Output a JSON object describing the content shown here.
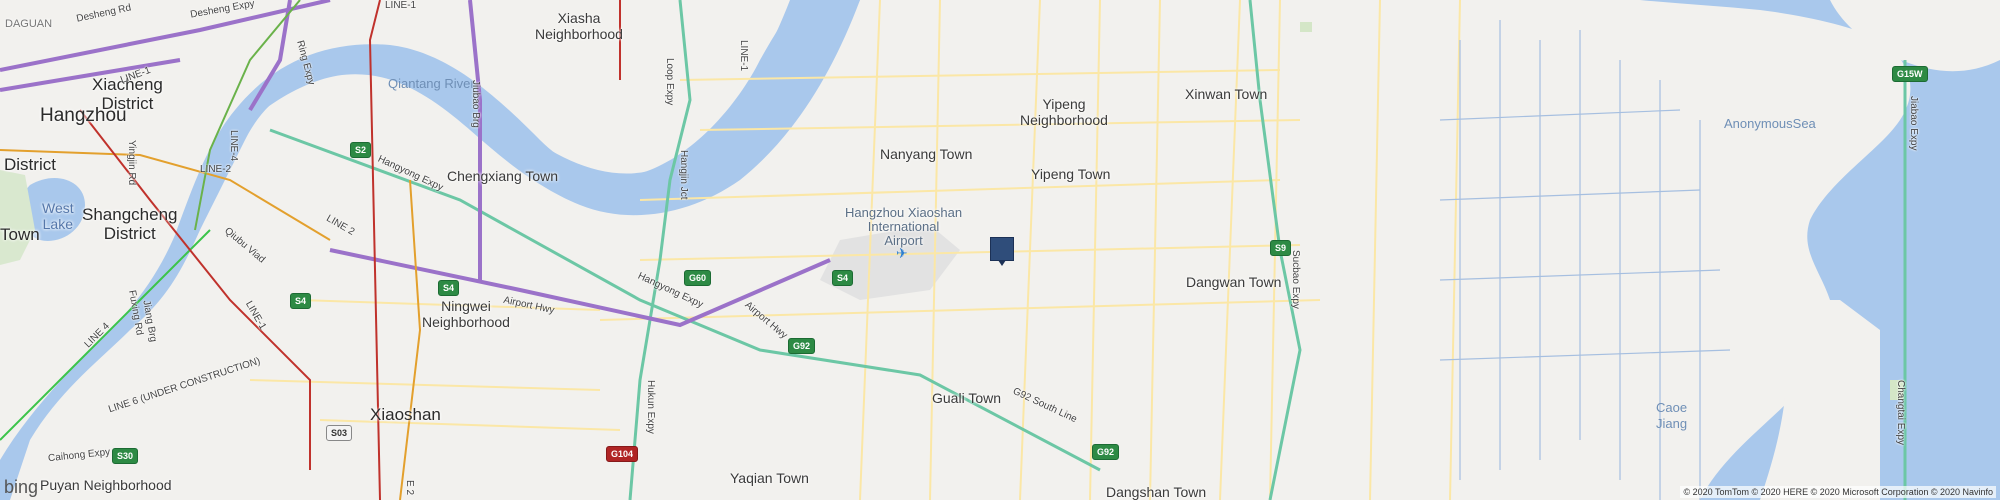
{
  "map": {
    "labels": {
      "daguan": "DAGUAN",
      "xiacheng": "Xiacheng\nDistrict",
      "hangzhou": "Hangzhou",
      "district": "District",
      "west_lake": "West\nLake",
      "town_left": "Town",
      "shangcheng": "Shangcheng\nDistrict",
      "xiasha": "Xiasha\nNeighborhood",
      "qiantang": "Qiantang River",
      "chengxiang": "Chengxiang Town",
      "ningwei": "Ningwei\nNeighborhood",
      "xiaoshan": "Xiaoshan",
      "puyan": "Puyan Neighborhood",
      "nanyang": "Nanyang Town",
      "yipeng_nb": "Yipeng\nNeighborhood",
      "yipeng_town": "Yipeng Town",
      "xinwan": "Xinwan Town",
      "airport": "Hangzhou Xiaoshan\nInternational\nAirport",
      "dangwan": "Dangwan Town",
      "guali": "Guali Town",
      "yaqian": "Yaqian Town",
      "dangshan": "Dangshan Town",
      "anonymous_sea": "AnonymousSea",
      "caoe": "Caoe\nJiang"
    },
    "roads": {
      "desheng1": "Desheng Rd",
      "desheng2": "Desheng Expy",
      "line1_top": "LINE-1",
      "line1_a": "LINE-1",
      "line1_b": "LINE-1",
      "line1_c": "LINE-1",
      "line2_a": "LINE 2",
      "line2_b": "LINE-2",
      "line4_a": "LINE-4",
      "line4_b": "LINE 4",
      "line6": "LINE 6 (UNDER CONSTRUCTION)",
      "hangyong1": "Hangyong Expy",
      "hangyong2": "Hangyong Expy",
      "airport_hwy": "Airport Hwy",
      "airport_hwy2": "Airport Hwy",
      "jiubao": "Jiubao Brg",
      "ring": "Ring Expy",
      "loop": "Loop Expy",
      "hangjin": "Hangjin Jct",
      "yingjin": "Yingjin Rd",
      "qiubu": "Qiubu Viad",
      "fuxing": "Fuxing Rd",
      "jiang_brg": "Jiang Brg",
      "hukun": "Hukun Expy",
      "g92_south": "G92 South Line",
      "sucbao": "Sucbao Expy",
      "jiabao": "Jiabao Expy",
      "changtai": "Changtai Expy",
      "cailing": "Caihong Expy",
      "e2": "E 2"
    },
    "shields": {
      "s2": "S2",
      "s4a": "S4",
      "s4b": "S4",
      "s4c": "S4",
      "g60": "G60",
      "g92a": "G92",
      "g92b": "G92",
      "s9": "S9",
      "g15w": "G15W",
      "s30": "S30",
      "g104": "G104",
      "s03": "S03"
    },
    "attribution": "© 2020 TomTom © 2020 HERE © 2020 Microsoft Corporation © 2020 Navinfo",
    "logo": "bing",
    "marker_icon": "location-marker-icon",
    "plane_icon": "airport-icon"
  }
}
